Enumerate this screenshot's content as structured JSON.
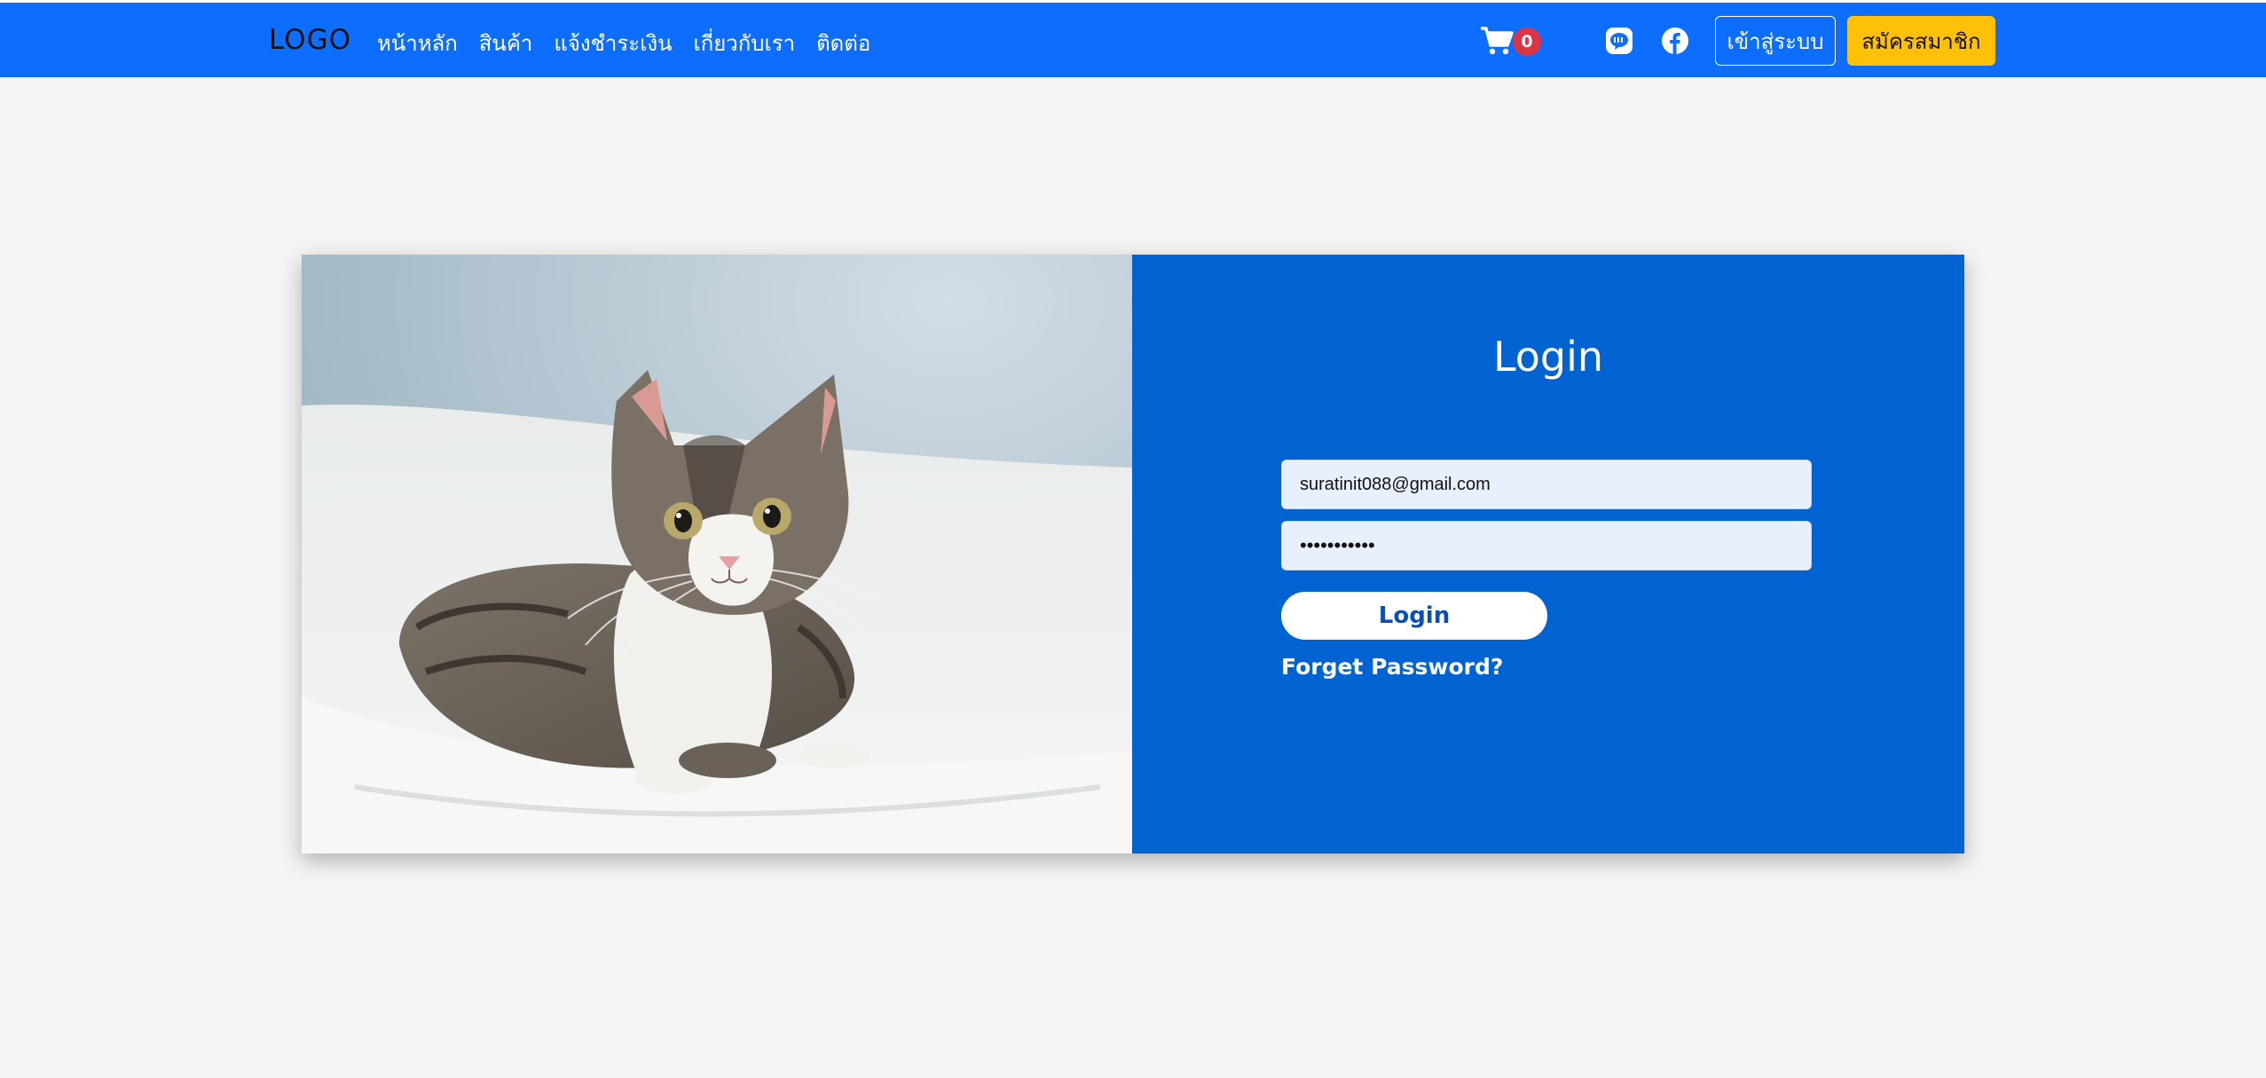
{
  "navbar": {
    "logo": "LOGO",
    "links": [
      "หน้าหลัก",
      "สินค้า",
      "แจ้งชำระเงิน",
      "เกี่ยวกับเรา",
      "ติดต่อ"
    ],
    "cart_count": "0",
    "login_label": "เข้าสู่ระบบ",
    "register_label": "สมัครสมาชิก",
    "icons": [
      "cart-icon",
      "line-icon",
      "facebook-icon"
    ]
  },
  "login": {
    "title": "Login",
    "email_value": "suratinit088@gmail.com",
    "password_value": "•••••••••••",
    "submit_label": "Login",
    "forget_label": "Forget Password?"
  },
  "colors": {
    "navbar": "#0d6efd",
    "panel": "#0063d1",
    "register_button": "#ffc107",
    "badge": "#dc3545",
    "background": "#f4f4f4"
  }
}
